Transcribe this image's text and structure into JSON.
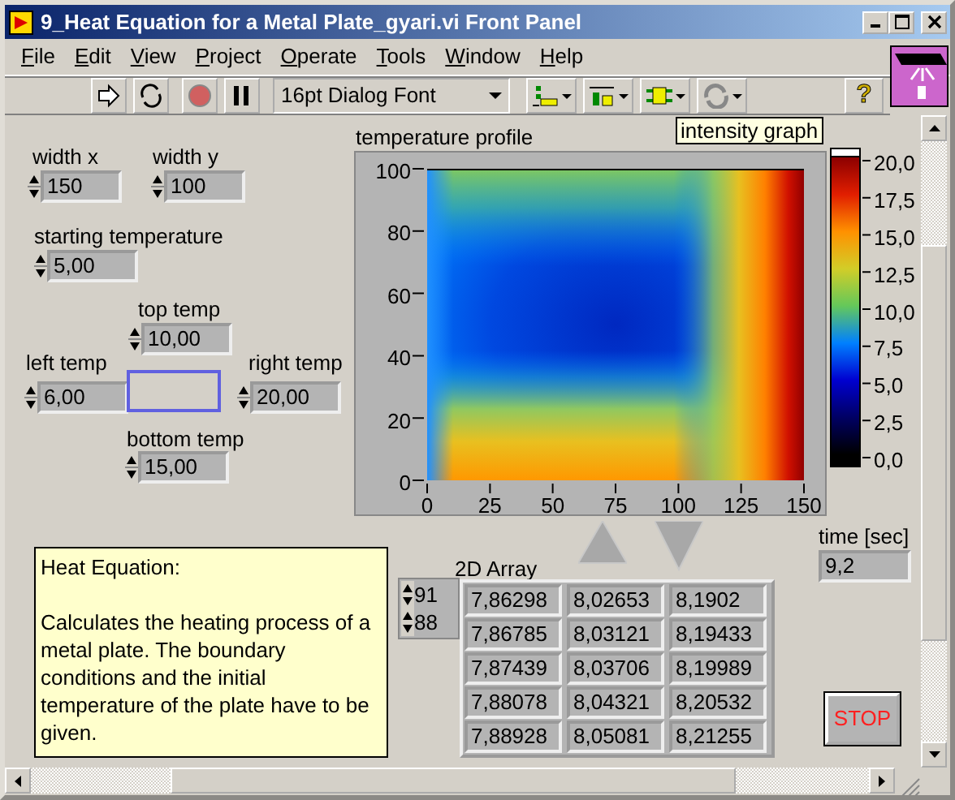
{
  "window": {
    "title": "9_Heat Equation for a Metal Plate_gyari.vi Front Panel"
  },
  "menu": [
    {
      "label": "File"
    },
    {
      "label": "Edit"
    },
    {
      "label": "View"
    },
    {
      "label": "Project"
    },
    {
      "label": "Operate"
    },
    {
      "label": "Tools"
    },
    {
      "label": "Window"
    },
    {
      "label": "Help"
    }
  ],
  "toolbar": {
    "font": "16pt Dialog Font",
    "help": "?"
  },
  "tooltip": "intensity graph",
  "controls": [
    {
      "label": "width x",
      "value": "150"
    },
    {
      "label": "width y",
      "value": "100"
    },
    {
      "label": "starting temperature",
      "value": "5,00"
    },
    {
      "label": "top temp",
      "value": "10,00"
    },
    {
      "label": "left temp",
      "value": "6,00"
    },
    {
      "label": "right temp",
      "value": "20,00"
    },
    {
      "label": "bottom temp",
      "value": "15,00"
    }
  ],
  "graph": {
    "title": "temperature profile",
    "y_ticks": [
      "100",
      "80",
      "60",
      "40",
      "20",
      "0"
    ],
    "x_ticks": [
      "0",
      "25",
      "50",
      "75",
      "100",
      "125",
      "150"
    ],
    "scale_ticks": [
      "20,0",
      "17,5",
      "15,0",
      "12,5",
      "10,0",
      "7,5",
      "5,0",
      "2,5",
      "0,0"
    ]
  },
  "description": {
    "heading": "Heat Equation:",
    "body": "Calculates the heating process of a metal plate. The boundary conditions and the initial temperature of the plate have to be given."
  },
  "array": {
    "label": "2D Array",
    "indices": [
      "91",
      "88"
    ],
    "rows": [
      [
        "7,86298",
        "8,02653",
        "8,1902"
      ],
      [
        "7,86785",
        "8,03121",
        "8,19433"
      ],
      [
        "7,87439",
        "8,03706",
        "8,19989"
      ],
      [
        "7,88078",
        "8,04321",
        "8,20532"
      ],
      [
        "7,88928",
        "8,05081",
        "8,21255"
      ]
    ]
  },
  "time": {
    "label": "time [sec]",
    "value": "9,2"
  },
  "stop_button": {
    "label": "STOP"
  }
}
